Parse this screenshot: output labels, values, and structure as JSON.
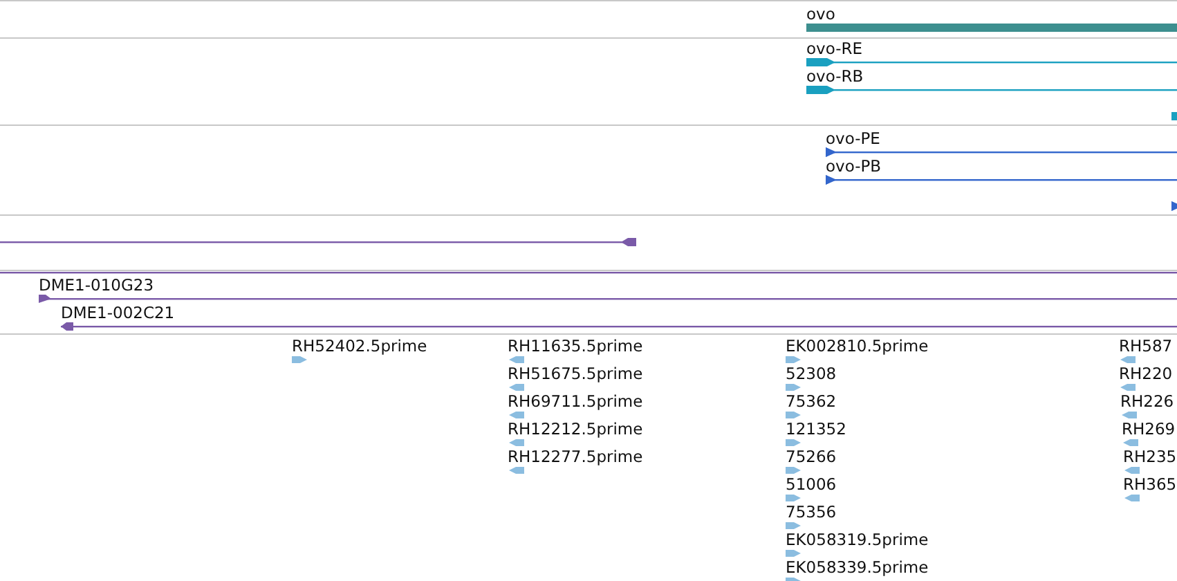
{
  "tracks": [
    {
      "kind": "gene",
      "features": [
        {
          "label": "ovo"
        }
      ]
    },
    {
      "kind": "transcript",
      "features": [
        {
          "label": "ovo-RE",
          "reverse": false
        },
        {
          "label": "ovo-RB",
          "reverse": false
        },
        {
          "reverse": false
        }
      ]
    },
    {
      "kind": "protein",
      "features": [
        {
          "label": "ovo-PE",
          "reverse": false
        },
        {
          "label": "ovo-PB",
          "reverse": false
        },
        {
          "reverse": false
        }
      ]
    },
    {
      "kind": "clone",
      "features": [
        {
          "reverse": true
        }
      ]
    },
    {
      "kind": "clone",
      "features": [
        {
          "truncated": true
        },
        {
          "label": "DME1-010G23",
          "reverse": false
        },
        {
          "label": "DME1-002C21",
          "reverse": true
        }
      ]
    },
    {
      "kind": "est",
      "features": [
        {
          "label": "RH52402.5prime",
          "reverse": false
        },
        {
          "label": "RH11635.5prime",
          "reverse": true
        },
        {
          "label": "RH51675.5prime",
          "reverse": true
        },
        {
          "label": "RH69711.5prime",
          "reverse": true
        },
        {
          "label": "RH12212.5prime",
          "reverse": true
        },
        {
          "label": "RH12277.5prime",
          "reverse": true
        },
        {
          "label": "EK002810.5prime",
          "reverse": false
        },
        {
          "label": "52308",
          "reverse": false
        },
        {
          "label": "75362",
          "reverse": false
        },
        {
          "label": "121352",
          "reverse": false
        },
        {
          "label": "75266",
          "reverse": false
        },
        {
          "label": "51006",
          "reverse": false
        },
        {
          "label": "75356",
          "reverse": false
        },
        {
          "label": "EK058319.5prime",
          "reverse": false
        },
        {
          "label": "EK058339.5prime",
          "reverse": false
        },
        {
          "label": "RH587",
          "reverse": true
        },
        {
          "label": "RH220",
          "reverse": true
        },
        {
          "label": "RH226",
          "reverse": true
        },
        {
          "label": "RH269",
          "reverse": true
        },
        {
          "label": "RH235",
          "reverse": true
        },
        {
          "label": "RH365",
          "reverse": true
        }
      ]
    }
  ]
}
